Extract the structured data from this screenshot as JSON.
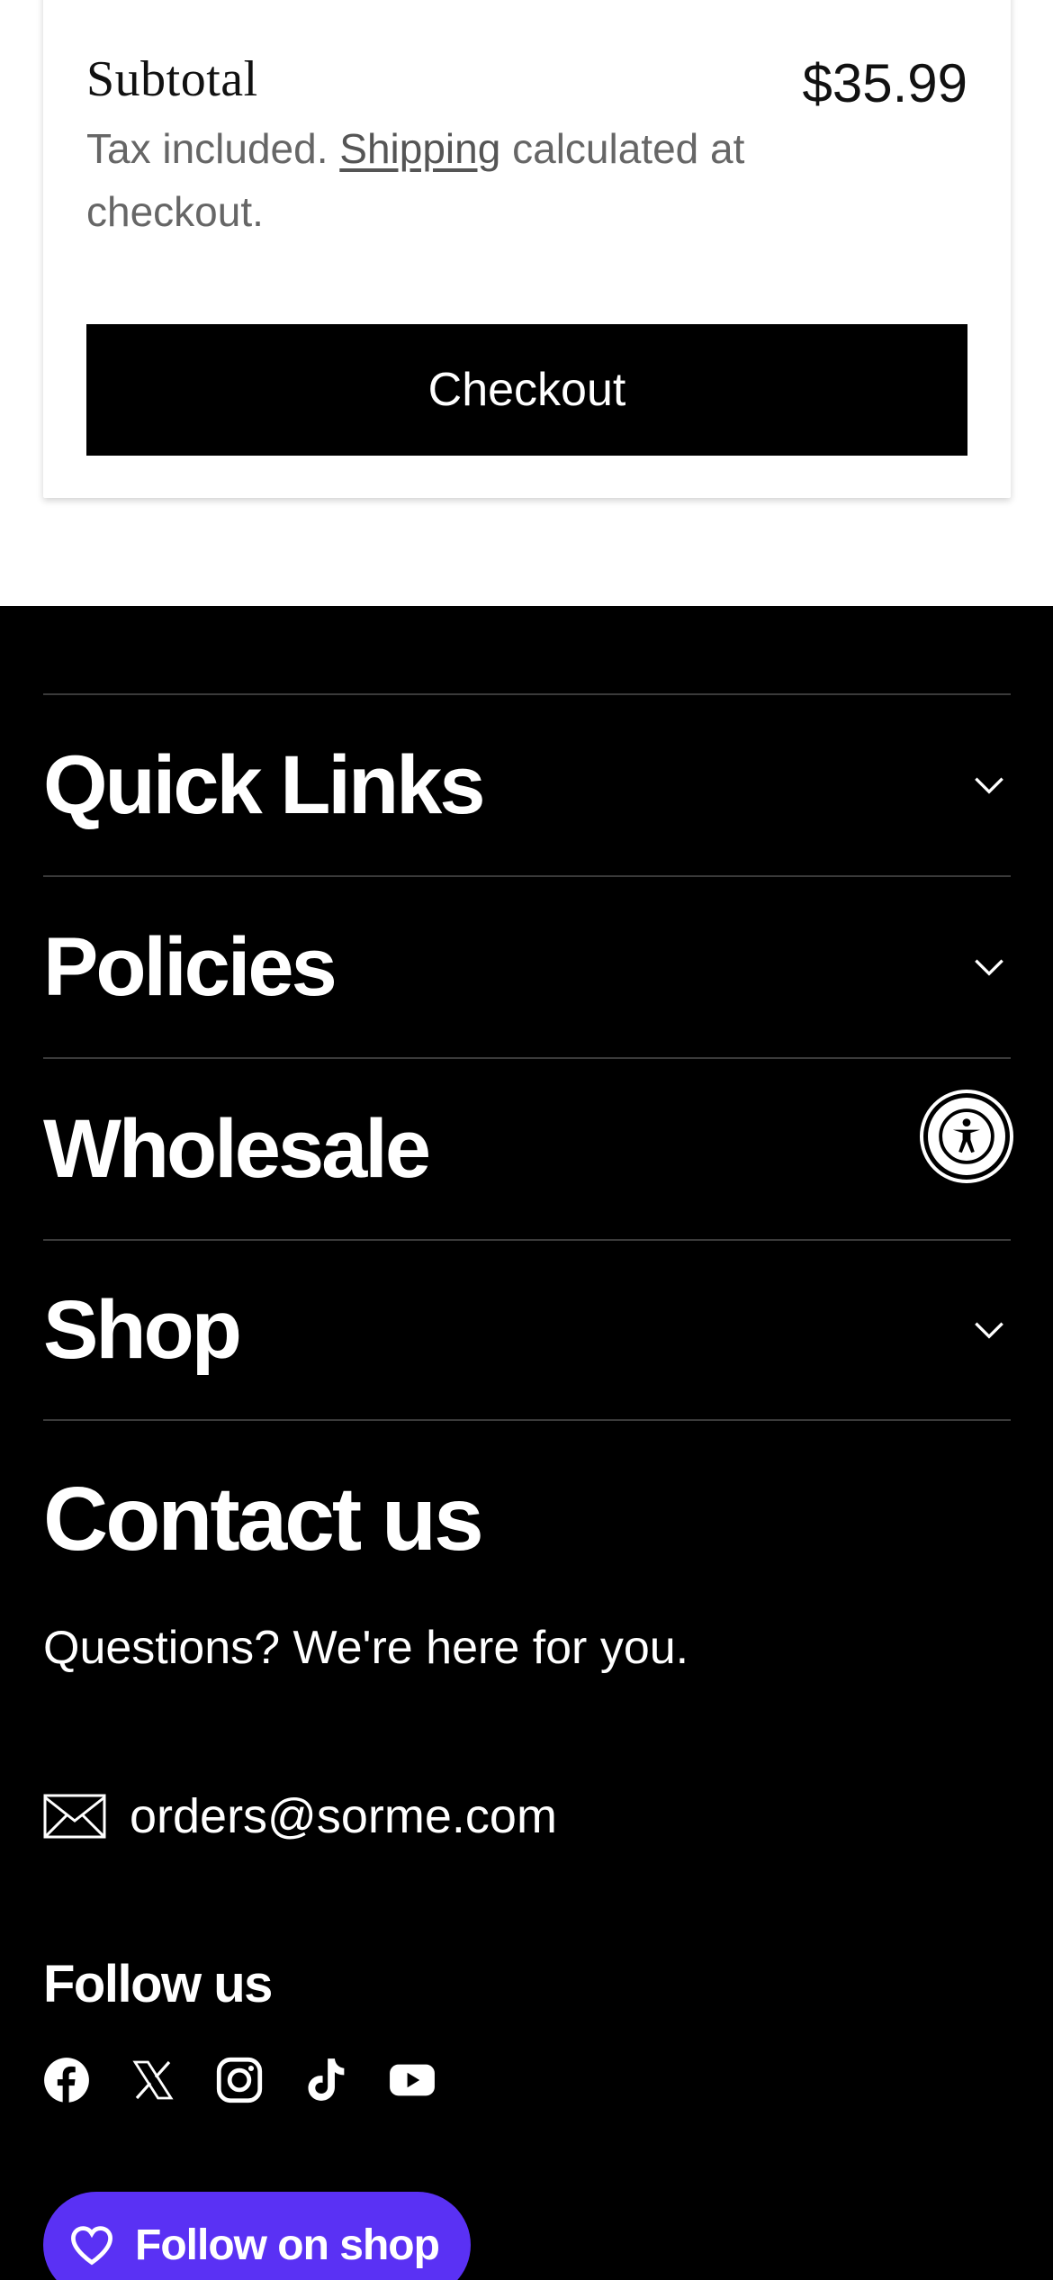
{
  "cart": {
    "subtotal_label": "Subtotal",
    "subtotal_value": "$35.99",
    "tax_prefix": "Tax included. ",
    "shipping_link": "Shipping",
    "tax_suffix": " calculated at checkout.",
    "checkout_label": "Checkout"
  },
  "footer": {
    "sections": [
      {
        "label": "Quick Links",
        "icon": "chevron-down-icon"
      },
      {
        "label": "Policies",
        "icon": "chevron-down-icon"
      },
      {
        "label": "Wholesale",
        "icon": "chevron-down-icon"
      },
      {
        "label": "Shop",
        "icon": "chevron-down-icon"
      }
    ],
    "contact_title": "Contact us",
    "contact_subtitle": "Questions? We're here for you.",
    "email": "orders@sorme.com",
    "follow_title": "Follow us",
    "socials": [
      "facebook-icon",
      "x-icon",
      "instagram-icon",
      "tiktok-icon",
      "youtube-icon"
    ],
    "shop_follow_label": "Follow on shop"
  },
  "colors": {
    "footer_bg": "#000000",
    "shop_purple": "#5a31f4",
    "divider": "#3a3a3a"
  }
}
